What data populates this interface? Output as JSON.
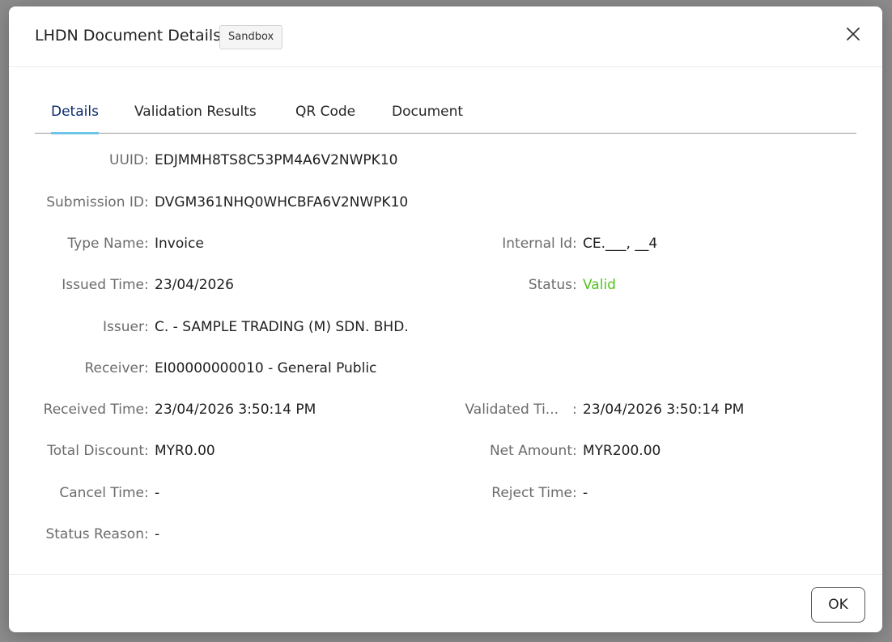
{
  "modal": {
    "title": "LHDN Document Details",
    "env_badge": "Sandbox",
    "ok_label": "OK"
  },
  "tabs": [
    {
      "label": "Details",
      "active": true
    },
    {
      "label": "Validation Results",
      "active": false
    },
    {
      "label": "QR Code",
      "active": false
    },
    {
      "label": "Document",
      "active": false
    }
  ],
  "details": {
    "uuid": {
      "label": "UUID",
      "value": "EDJMMH8TS8C53PM4A6V2NWPK10"
    },
    "submission_id": {
      "label": "Submission ID",
      "value": "DVGM361NHQ0WHCBFA6V2NWPK10"
    },
    "type_name": {
      "label": "Type Name",
      "value": "Invoice"
    },
    "internal_id": {
      "label": "Internal Id",
      "value": "CE.___, __4"
    },
    "issued_time": {
      "label": "Issued Time",
      "value": "23/04/2026"
    },
    "status": {
      "label": "Status",
      "value": "Valid"
    },
    "issuer": {
      "label": "Issuer",
      "value": "C.          - SAMPLE TRADING (M) SDN. BHD."
    },
    "receiver": {
      "label": "Receiver",
      "value": "EI00000000010 - General Public"
    },
    "received_time": {
      "label": "Received Time",
      "value": "23/04/2026 3:50:14 PM"
    },
    "validated_time": {
      "label": "Validated Ti...",
      "value": "23/04/2026 3:50:14 PM"
    },
    "total_discount": {
      "label": "Total Discount",
      "value": "MYR0.00"
    },
    "net_amount": {
      "label": "Net Amount",
      "value": "MYR200.00"
    },
    "cancel_time": {
      "label": "Cancel Time",
      "value": "-"
    },
    "reject_time": {
      "label": "Reject Time",
      "value": "-"
    },
    "status_reason": {
      "label": "Status Reason",
      "value": "-"
    }
  },
  "colors": {
    "status_valid": "#52c41a",
    "tab_active": "#0b2a6b",
    "tab_ink": "#6ec3e8"
  },
  "icons": {
    "close": "close-icon"
  }
}
